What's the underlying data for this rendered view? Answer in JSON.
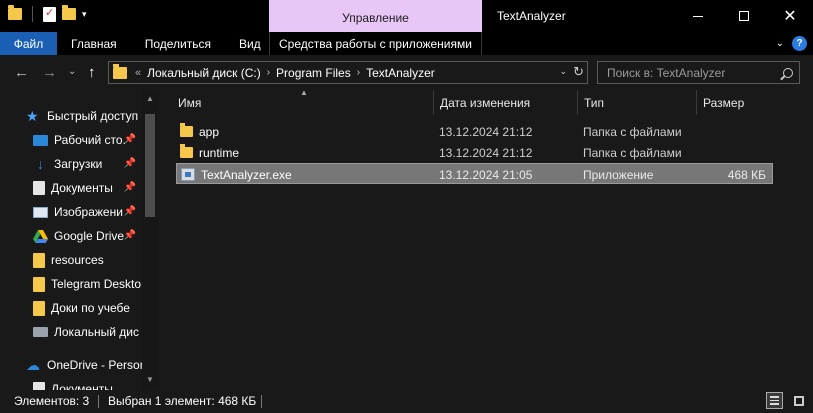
{
  "window": {
    "title": "TextAnalyzer",
    "context_tab": "Управление",
    "close_glyph": "✕"
  },
  "ribbon": {
    "tabs": [
      "Файл",
      "Главная",
      "Поделиться",
      "Вид"
    ],
    "context_tools": "Средства работы с приложениями",
    "help": "?",
    "file_tab_color": "#1a5fb4",
    "context_color": "#e8c6f5"
  },
  "nav": {
    "back": "←",
    "forward": "→",
    "recent": "⌄",
    "up": "↑"
  },
  "address": {
    "overflow": "«",
    "crumbs": [
      "Локальный диск (C:)",
      "Program Files",
      "TextAnalyzer"
    ]
  },
  "search": {
    "placeholder": "Поиск в: TextAnalyzer"
  },
  "sidebar": {
    "items": [
      {
        "label": "Быстрый доступ",
        "icon": "star-icon"
      },
      {
        "label": "Рабочий сто.",
        "icon": "desktop-icon",
        "pinned": true
      },
      {
        "label": "Загрузки",
        "icon": "download-icon",
        "pinned": true
      },
      {
        "label": "Документы",
        "icon": "documents-icon",
        "pinned": true
      },
      {
        "label": "Изображени",
        "icon": "pictures-icon",
        "pinned": true
      },
      {
        "label": "Google Drive",
        "icon": "google-drive-icon",
        "pinned": true
      },
      {
        "label": "resources",
        "icon": "folder-icon"
      },
      {
        "label": "Telegram Deskto",
        "icon": "folder-icon"
      },
      {
        "label": "Доки по учебе",
        "icon": "folder-icon"
      },
      {
        "label": "Локальный дис",
        "icon": "drive-icon"
      },
      {
        "label": "OneDrive - Persor",
        "icon": "onedrive-icon"
      },
      {
        "label": "Документы",
        "icon": "documents-icon"
      }
    ]
  },
  "columns": {
    "name": "Имя",
    "date": "Дата изменения",
    "type": "Тип",
    "size": "Размер"
  },
  "files": [
    {
      "name": "app",
      "date": "13.12.2024 21:12",
      "type": "Папка с файлами",
      "size": "",
      "kind": "folder"
    },
    {
      "name": "runtime",
      "date": "13.12.2024 21:12",
      "type": "Папка с файлами",
      "size": "",
      "kind": "folder"
    },
    {
      "name": "TextAnalyzer.exe",
      "date": "13.12.2024 21:05",
      "type": "Приложение",
      "size": "468 КБ",
      "kind": "exe",
      "selected": true
    }
  ],
  "status": {
    "items_count": "Элементов: 3",
    "selected": "Выбран 1 элемент: 468 КБ"
  }
}
